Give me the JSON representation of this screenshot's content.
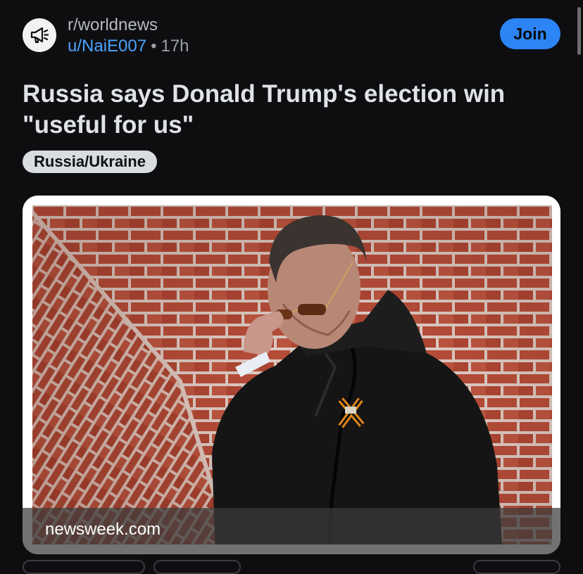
{
  "post": {
    "subreddit": "r/worldnews",
    "author": "u/NaiE007",
    "separator": "•",
    "age": "17h",
    "join_label": "Join",
    "title": "Russia says Donald Trump's election win \"useful for us\"",
    "flair": "Russia/Ukraine"
  },
  "link_preview": {
    "domain": "newsweek.com"
  },
  "icons": {
    "subreddit_avatar": "megaphone-icon"
  },
  "colors": {
    "background": "#0e0e10",
    "join_button": "#2c84f5",
    "username": "#4da3ff",
    "flair_bg": "#d9dce1"
  }
}
